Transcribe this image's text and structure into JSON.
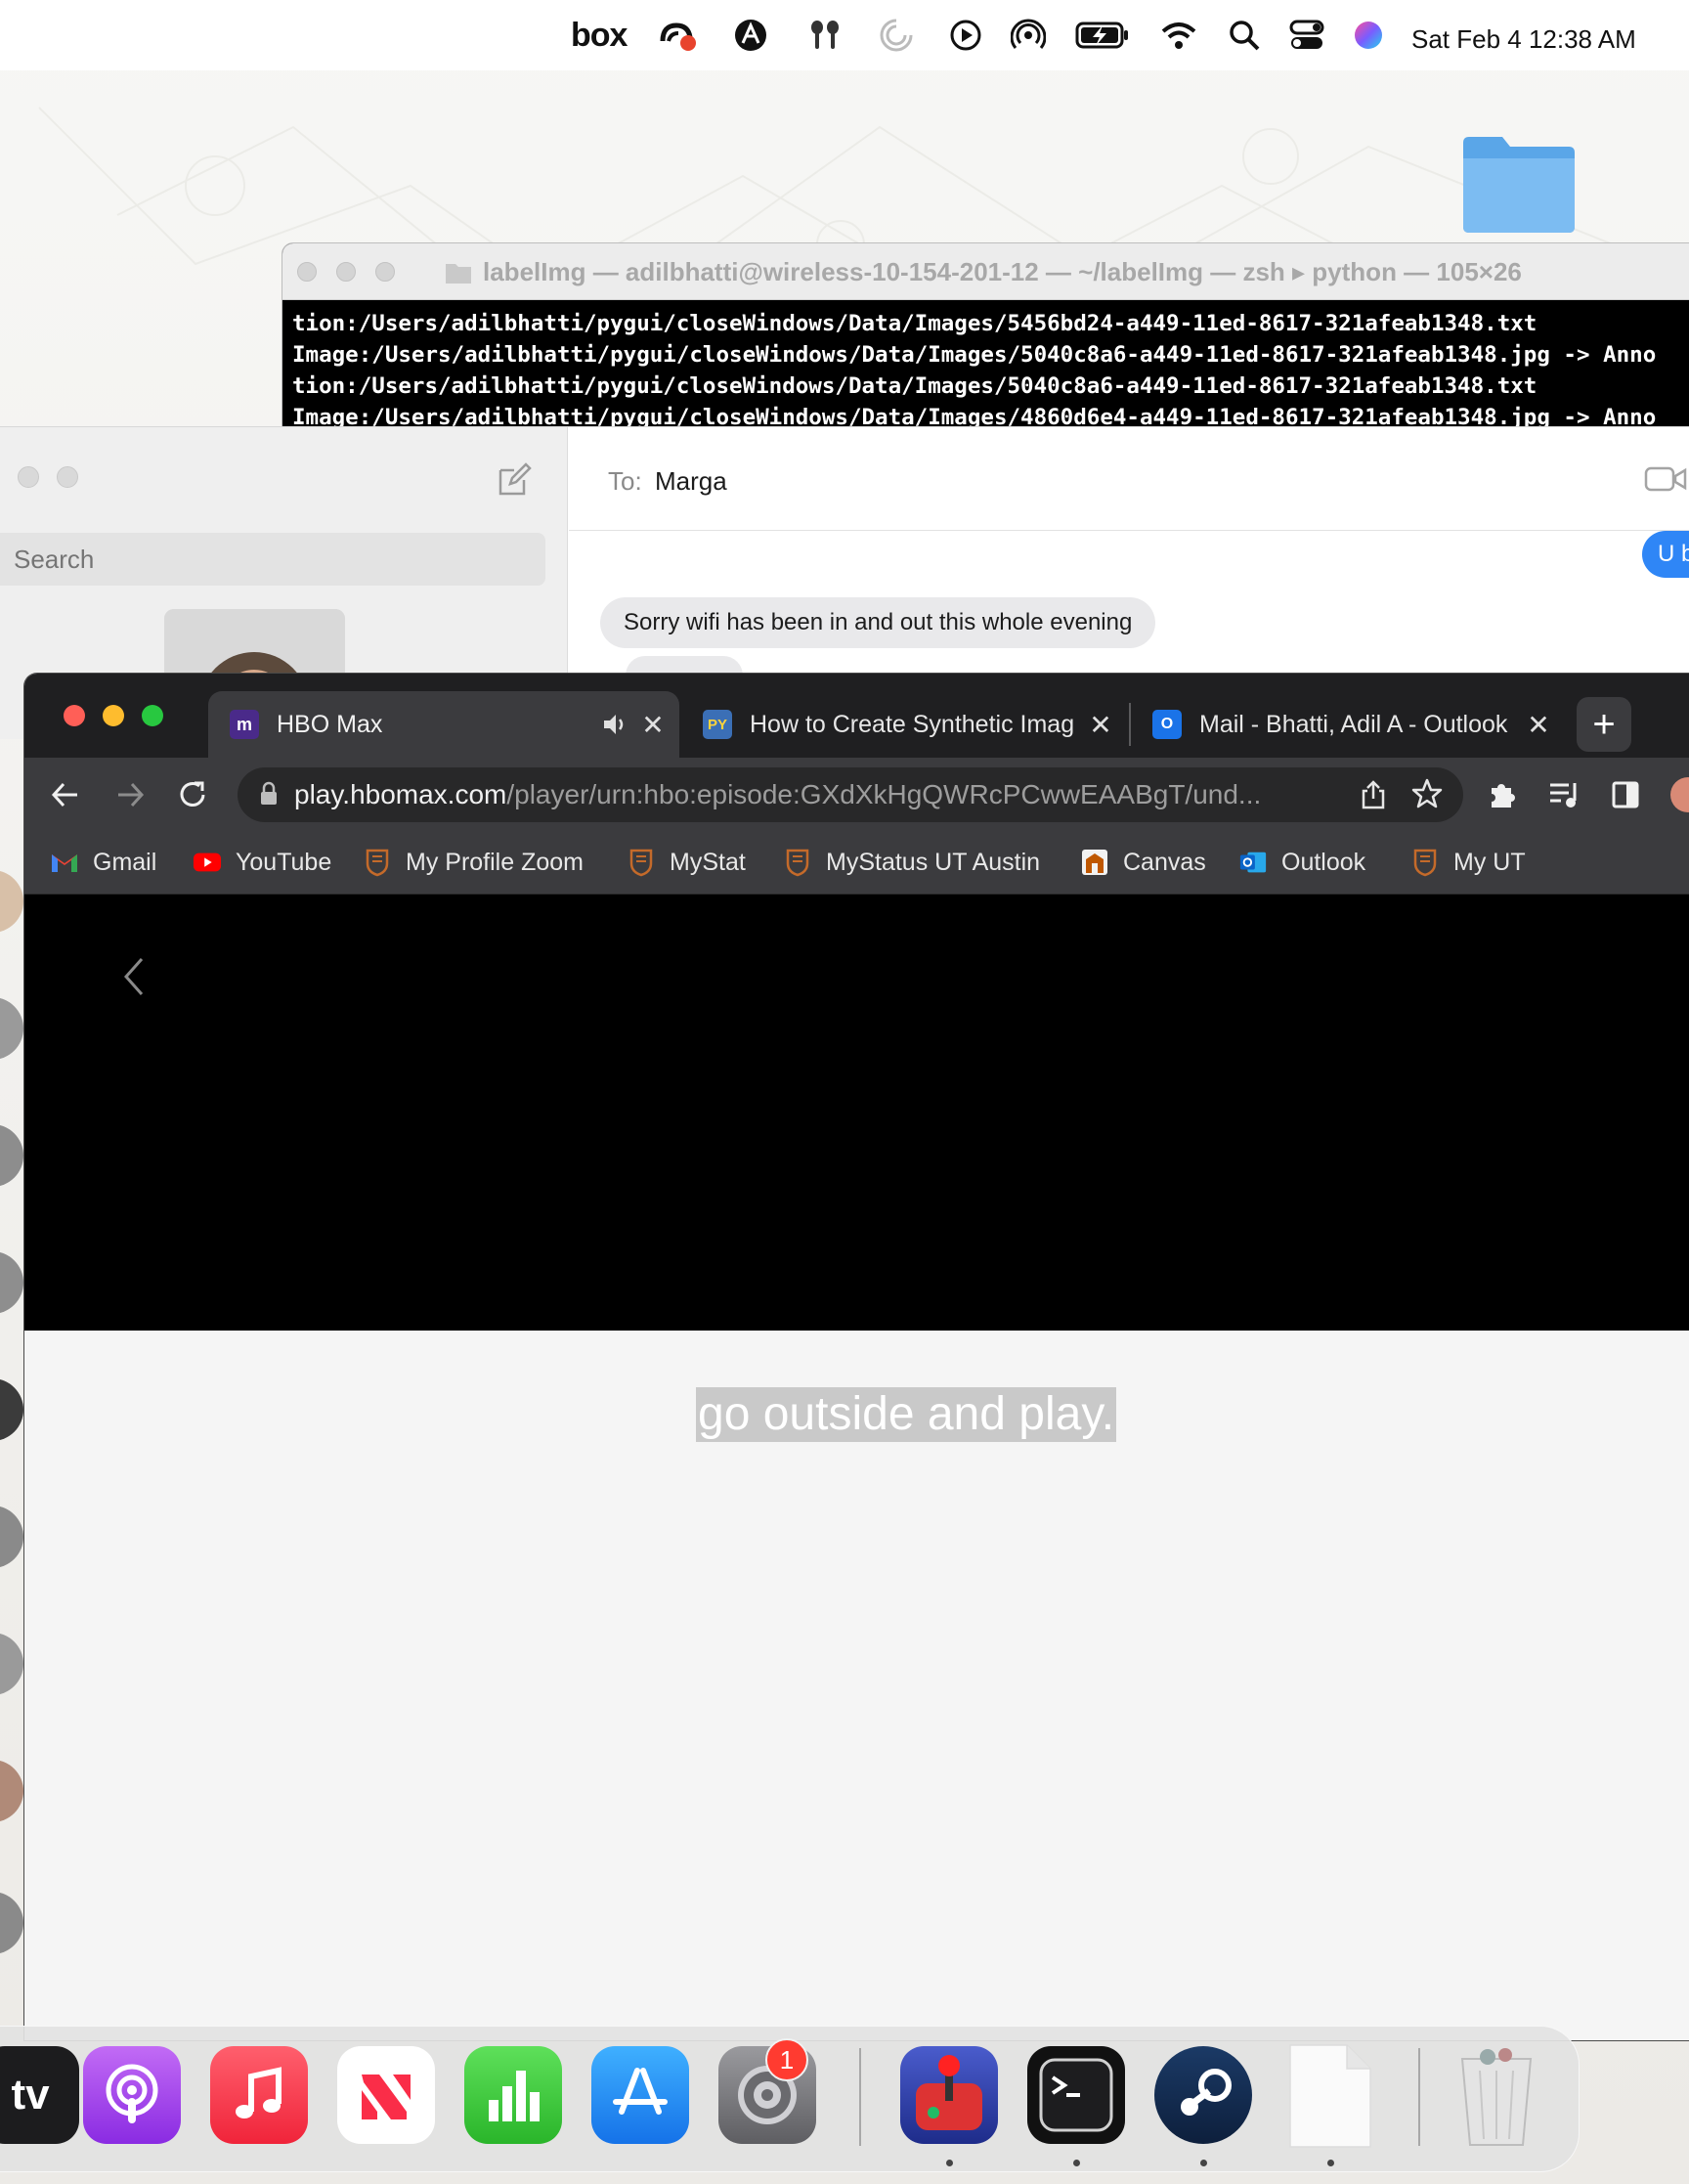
{
  "menubar": {
    "box_label": "box",
    "clock": "Sat Feb 4  12:38 AM"
  },
  "terminal": {
    "title": "labelImg — adilbhatti@wireless-10-154-201-12 — ~/labelImg — zsh ▸ python — 105×26",
    "lines": [
      "tion:/Users/adilbhatti/pygui/closeWindows/Data/Images/5456bd24-a449-11ed-8617-321afeab1348.txt",
      "Image:/Users/adilbhatti/pygui/closeWindows/Data/Images/5040c8a6-a449-11ed-8617-321afeab1348.jpg -> Anno",
      "tion:/Users/adilbhatti/pygui/closeWindows/Data/Images/5040c8a6-a449-11ed-8617-321afeab1348.txt",
      "Image:/Users/adilbhatti/pygui/closeWindows/Data/Images/4860d6e4-a449-11ed-8617-321afeab1348.jpg -> Anno"
    ]
  },
  "messages": {
    "search_placeholder": "Search",
    "to_label": "To:",
    "to_name": "Marga",
    "outgoing_partial": "U b",
    "incoming": "Sorry wifi has been in and out this whole evening"
  },
  "browser": {
    "tabs": [
      {
        "label": "HBO Max",
        "favicon": "m",
        "active": true
      },
      {
        "label": "How to Create Synthetic Imag",
        "favicon": "PY",
        "active": false
      },
      {
        "label": "Mail - Bhatti, Adil A - Outlook",
        "favicon": "O",
        "active": false
      }
    ],
    "url_host": "play.hbomax.com",
    "url_path": "/player/urn:hbo:episode:GXdXkHgQWRcPCwwEAABgT/und...",
    "bookmarks": [
      "Gmail",
      "YouTube",
      "My Profile Zoom",
      "MyStat",
      "MyStatus UT Austin",
      "Canvas",
      "Outlook",
      "My UT"
    ],
    "subtitle": "go outside and play."
  },
  "dock": {
    "tv_label": "tv",
    "settings_badge": "1"
  }
}
